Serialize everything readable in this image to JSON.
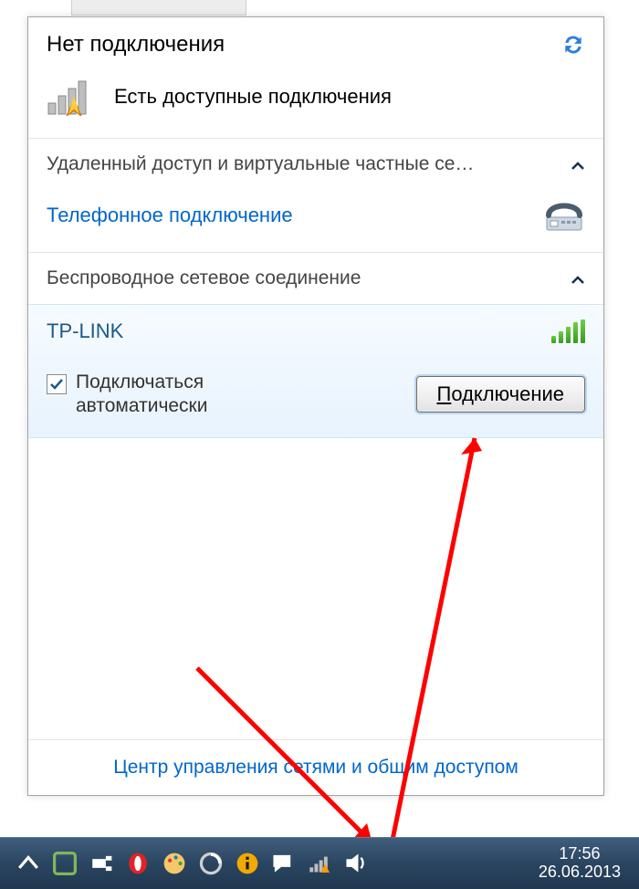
{
  "header": {
    "title": "Нет подключения"
  },
  "available": {
    "label": "Есть доступные подключения"
  },
  "sections": {
    "remote": {
      "title": "Удаленный доступ и виртуальные частные се…"
    },
    "dial": {
      "label": "Телефонное подключение"
    },
    "wireless": {
      "title": "Беспроводное сетевое соединение"
    }
  },
  "network": {
    "name": "TP-LINK",
    "auto_label": "Подключаться автоматически",
    "auto_checked": true,
    "connect_btn_prefix": "П",
    "connect_btn_suffix": "одключение"
  },
  "footer": {
    "link": "Центр управления сетями и общим доступом"
  },
  "taskbar": {
    "time": "17:56",
    "date": "26.06.2013"
  }
}
